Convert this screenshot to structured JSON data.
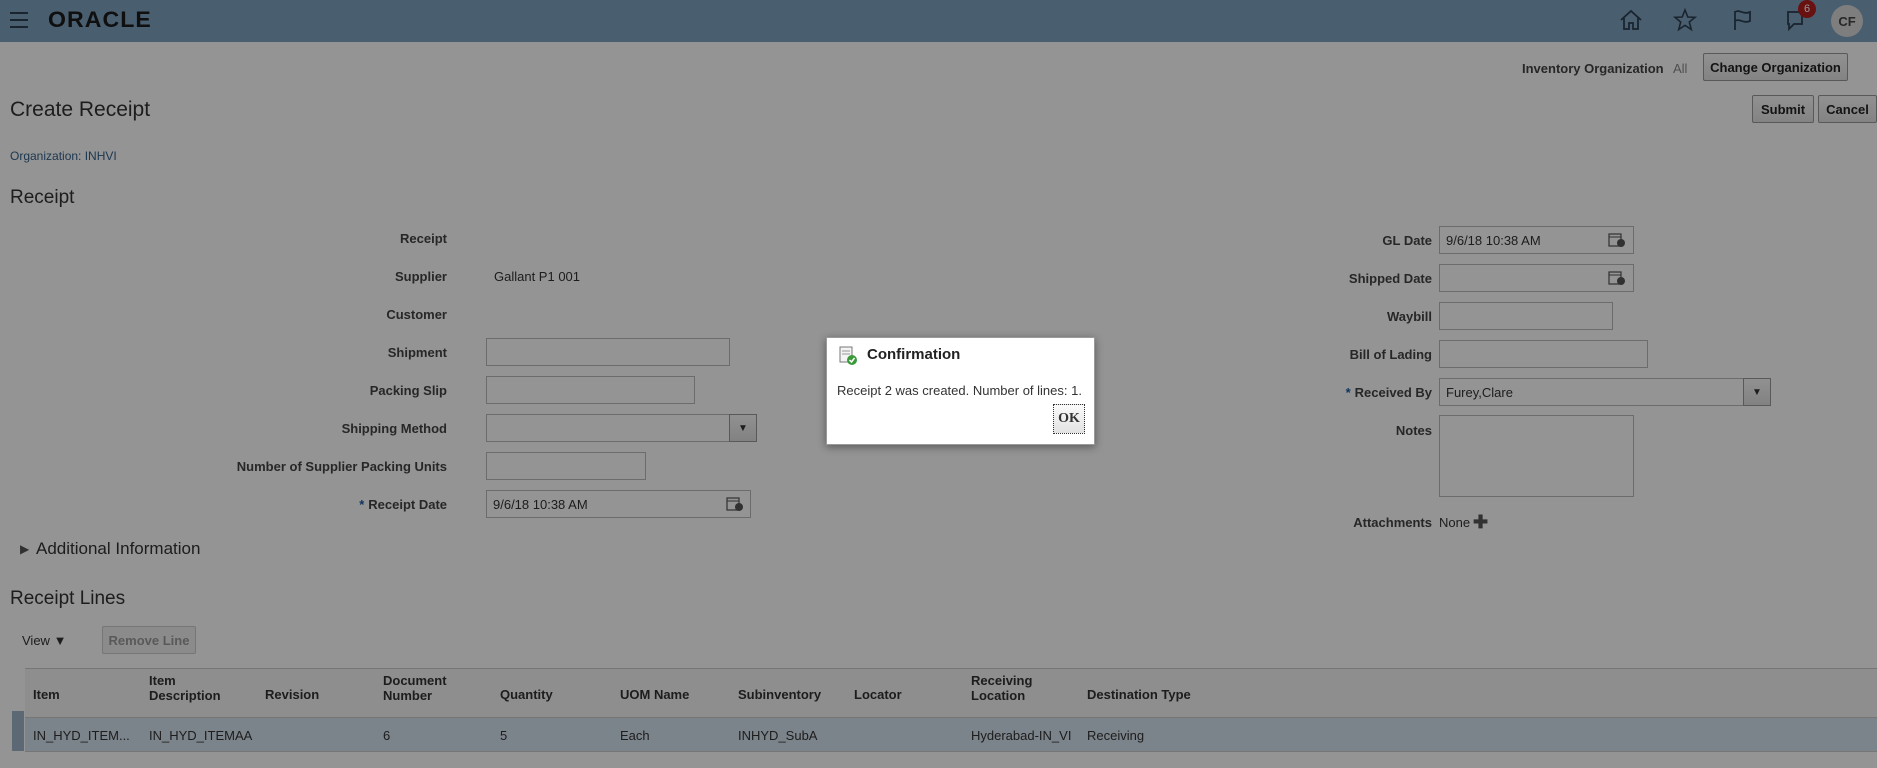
{
  "topbar": {
    "logo": "ORACLE",
    "notification_count": "6",
    "avatar_initials": "CF"
  },
  "header": {
    "inventory_org_label": "Inventory Organization",
    "inventory_org_value": "All",
    "change_org_button": "Change Organization"
  },
  "page": {
    "title": "Create Receipt",
    "organization": "Organization: INHVI",
    "submit_button": "Submit",
    "cancel_button": "Cancel"
  },
  "receipt": {
    "section_title": "Receipt",
    "receipt_label": "Receipt",
    "receipt_value": "",
    "supplier_label": "Supplier",
    "supplier_value": "Gallant P1 001",
    "customer_label": "Customer",
    "shipment_label": "Shipment",
    "packing_slip_label": "Packing Slip",
    "shipping_method_label": "Shipping Method",
    "num_packing_units_label": "Number of Supplier Packing Units",
    "receipt_date_label": "Receipt Date",
    "receipt_date_value": "9/6/18 10:38 AM",
    "gl_date_label": "GL Date",
    "gl_date_value": "9/6/18 10:38 AM",
    "shipped_date_label": "Shipped Date",
    "waybill_label": "Waybill",
    "bill_of_lading_label": "Bill of Lading",
    "received_by_label": "Received By",
    "received_by_value": "Furey,Clare",
    "notes_label": "Notes",
    "attachments_label": "Attachments",
    "attachments_value": "None",
    "required_marker": "*"
  },
  "additional_info": {
    "title": "Additional Information"
  },
  "receipt_lines": {
    "section_title": "Receipt Lines",
    "view_menu": "View",
    "remove_line_button": "Remove Line",
    "columns": [
      "Item",
      "Item\nDescription",
      "Revision",
      "Document\nNumber",
      "Quantity",
      "UOM Name",
      "Subinventory",
      "Locator",
      "Receiving\nLocation",
      "Destination Type"
    ],
    "rows": [
      {
        "item": "IN_HYD_ITEM...",
        "description": "IN_HYD_ITEMAA",
        "revision": "",
        "document_number": "6",
        "quantity": "5",
        "uom": "Each",
        "subinventory": "INHYD_SubA",
        "locator": "",
        "receiving_location": "Hyderabad-IN_VI",
        "destination_type": "Receiving"
      }
    ]
  },
  "dialog": {
    "title": "Confirmation",
    "message": "Receipt 2 was created. Number of lines: 1.",
    "ok_button": "OK"
  }
}
